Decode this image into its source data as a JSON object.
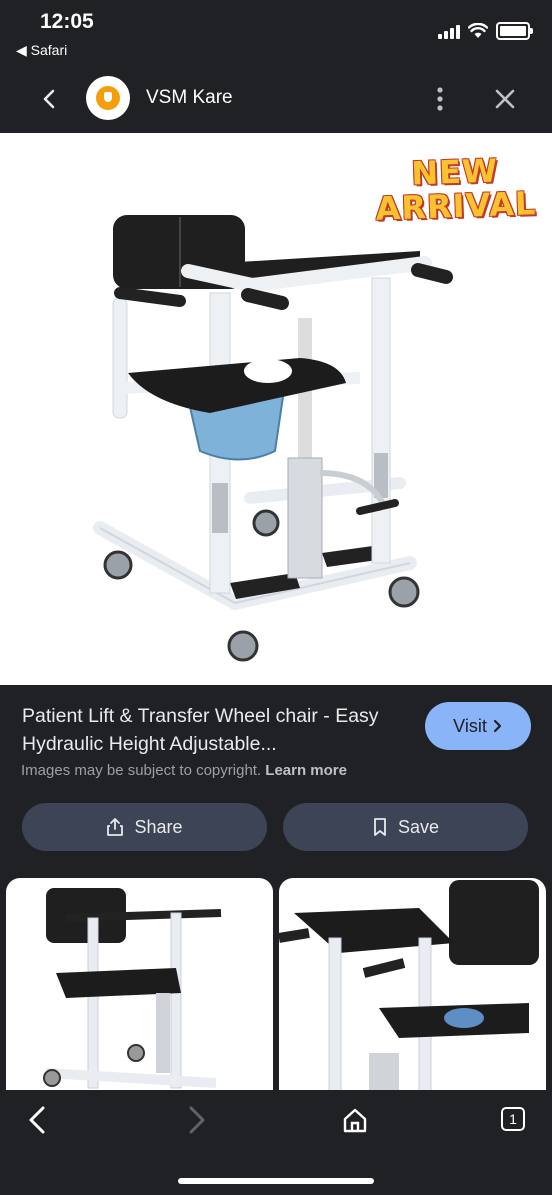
{
  "status_bar": {
    "time": "12:05",
    "back_app": "◀ Safari"
  },
  "header": {
    "site_name": "VSM Kare"
  },
  "hero": {
    "badge_line1": "NEW",
    "badge_line2": "ARRIVAL"
  },
  "result": {
    "title": "Patient Lift & Transfer Wheel chair - Easy Hydraulic Height Adjustable...",
    "visit_label": "Visit",
    "copyright_text": "Images may be subject to copyright.",
    "learn_more": "Learn more"
  },
  "actions": {
    "share_label": "Share",
    "save_label": "Save"
  },
  "bottom_bar": {
    "tab_count": "1"
  },
  "colors": {
    "background": "#202124",
    "visit_button": "#8ab4f8",
    "action_button": "#3c4455",
    "badge": "#f9c22e"
  }
}
